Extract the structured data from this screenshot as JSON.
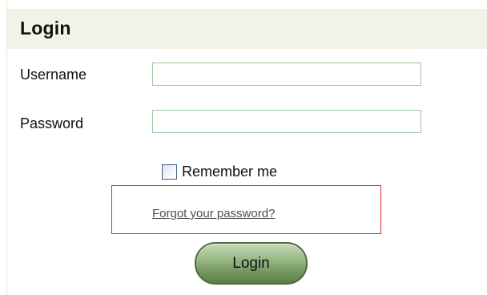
{
  "header": {
    "title": "Login"
  },
  "form": {
    "username_label": "Username",
    "username_value": "",
    "password_label": "Password",
    "password_value": "",
    "remember_label": "Remember me",
    "remember_checked": false,
    "forgot_link": "Forgot your password?",
    "submit_label": "Login"
  },
  "colors": {
    "header_bg": "#f2f3e6",
    "input_border": "#98c79d",
    "highlight_border": "#e0262a",
    "button_green": "#6f9459"
  }
}
